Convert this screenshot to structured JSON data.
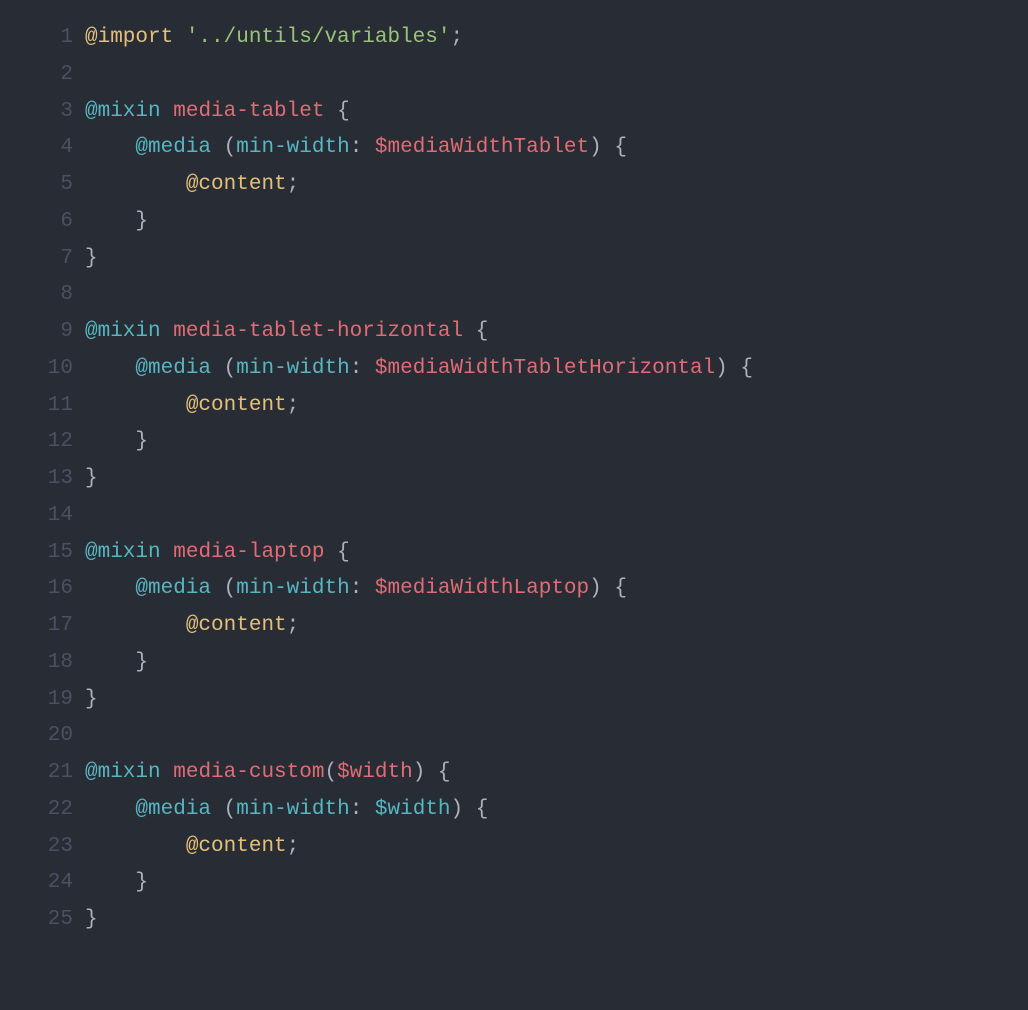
{
  "code": {
    "lines": [
      {
        "num": "1",
        "tokens": [
          {
            "cls": "t-import",
            "text": "@import"
          },
          {
            "cls": "t-punct",
            "text": " "
          },
          {
            "cls": "t-string",
            "text": "'../untils/variables'"
          },
          {
            "cls": "t-punct",
            "text": ";"
          }
        ]
      },
      {
        "num": "2",
        "tokens": []
      },
      {
        "num": "3",
        "tokens": [
          {
            "cls": "t-at",
            "text": "@mixin"
          },
          {
            "cls": "t-punct",
            "text": " "
          },
          {
            "cls": "t-mixin-name",
            "text": "media-tablet"
          },
          {
            "cls": "t-punct",
            "text": " "
          },
          {
            "cls": "t-brace",
            "text": "{"
          }
        ]
      },
      {
        "num": "4",
        "tokens": [
          {
            "cls": "t-punct",
            "text": "    "
          },
          {
            "cls": "t-at",
            "text": "@media"
          },
          {
            "cls": "t-punct",
            "text": " ("
          },
          {
            "cls": "t-prop",
            "text": "min-width"
          },
          {
            "cls": "t-punct",
            "text": ": "
          },
          {
            "cls": "t-var",
            "text": "$mediaWidthTablet"
          },
          {
            "cls": "t-punct",
            "text": ") "
          },
          {
            "cls": "t-brace",
            "text": "{"
          }
        ]
      },
      {
        "num": "5",
        "tokens": [
          {
            "cls": "t-punct",
            "text": "        "
          },
          {
            "cls": "t-content",
            "text": "@content"
          },
          {
            "cls": "t-punct",
            "text": ";"
          }
        ]
      },
      {
        "num": "6",
        "tokens": [
          {
            "cls": "t-punct",
            "text": "    "
          },
          {
            "cls": "t-brace",
            "text": "}"
          }
        ]
      },
      {
        "num": "7",
        "tokens": [
          {
            "cls": "t-brace",
            "text": "}"
          }
        ]
      },
      {
        "num": "8",
        "tokens": []
      },
      {
        "num": "9",
        "tokens": [
          {
            "cls": "t-at",
            "text": "@mixin"
          },
          {
            "cls": "t-punct",
            "text": " "
          },
          {
            "cls": "t-mixin-name",
            "text": "media-tablet-horizontal"
          },
          {
            "cls": "t-punct",
            "text": " "
          },
          {
            "cls": "t-brace",
            "text": "{"
          }
        ]
      },
      {
        "num": "10",
        "tokens": [
          {
            "cls": "t-punct",
            "text": "    "
          },
          {
            "cls": "t-at",
            "text": "@media"
          },
          {
            "cls": "t-punct",
            "text": " ("
          },
          {
            "cls": "t-prop",
            "text": "min-width"
          },
          {
            "cls": "t-punct",
            "text": ": "
          },
          {
            "cls": "t-var",
            "text": "$mediaWidthTabletHorizontal"
          },
          {
            "cls": "t-punct",
            "text": ") "
          },
          {
            "cls": "t-brace",
            "text": "{"
          }
        ]
      },
      {
        "num": "11",
        "tokens": [
          {
            "cls": "t-punct",
            "text": "        "
          },
          {
            "cls": "t-content",
            "text": "@content"
          },
          {
            "cls": "t-punct",
            "text": ";"
          }
        ]
      },
      {
        "num": "12",
        "tokens": [
          {
            "cls": "t-punct",
            "text": "    "
          },
          {
            "cls": "t-brace",
            "text": "}"
          }
        ]
      },
      {
        "num": "13",
        "tokens": [
          {
            "cls": "t-brace",
            "text": "}"
          }
        ]
      },
      {
        "num": "14",
        "tokens": []
      },
      {
        "num": "15",
        "tokens": [
          {
            "cls": "t-at",
            "text": "@mixin"
          },
          {
            "cls": "t-punct",
            "text": " "
          },
          {
            "cls": "t-mixin-name",
            "text": "media-laptop"
          },
          {
            "cls": "t-punct",
            "text": " "
          },
          {
            "cls": "t-brace",
            "text": "{"
          }
        ]
      },
      {
        "num": "16",
        "tokens": [
          {
            "cls": "t-punct",
            "text": "    "
          },
          {
            "cls": "t-at",
            "text": "@media"
          },
          {
            "cls": "t-punct",
            "text": " ("
          },
          {
            "cls": "t-prop",
            "text": "min-width"
          },
          {
            "cls": "t-punct",
            "text": ": "
          },
          {
            "cls": "t-var",
            "text": "$mediaWidthLaptop"
          },
          {
            "cls": "t-punct",
            "text": ") "
          },
          {
            "cls": "t-brace",
            "text": "{"
          }
        ]
      },
      {
        "num": "17",
        "tokens": [
          {
            "cls": "t-punct",
            "text": "        "
          },
          {
            "cls": "t-content",
            "text": "@content"
          },
          {
            "cls": "t-punct",
            "text": ";"
          }
        ]
      },
      {
        "num": "18",
        "tokens": [
          {
            "cls": "t-punct",
            "text": "    "
          },
          {
            "cls": "t-brace",
            "text": "}"
          }
        ]
      },
      {
        "num": "19",
        "tokens": [
          {
            "cls": "t-brace",
            "text": "}"
          }
        ]
      },
      {
        "num": "20",
        "tokens": []
      },
      {
        "num": "21",
        "tokens": [
          {
            "cls": "t-at",
            "text": "@mixin"
          },
          {
            "cls": "t-punct",
            "text": " "
          },
          {
            "cls": "t-mixin-name",
            "text": "media-custom"
          },
          {
            "cls": "t-punct",
            "text": "("
          },
          {
            "cls": "t-var",
            "text": "$width"
          },
          {
            "cls": "t-punct",
            "text": ") "
          },
          {
            "cls": "t-brace",
            "text": "{"
          }
        ]
      },
      {
        "num": "22",
        "tokens": [
          {
            "cls": "t-punct",
            "text": "    "
          },
          {
            "cls": "t-at",
            "text": "@media"
          },
          {
            "cls": "t-punct",
            "text": " ("
          },
          {
            "cls": "t-prop",
            "text": "min-width"
          },
          {
            "cls": "t-punct",
            "text": ": "
          },
          {
            "cls": "t-var-cyan",
            "text": "$width"
          },
          {
            "cls": "t-punct",
            "text": ") "
          },
          {
            "cls": "t-brace",
            "text": "{"
          }
        ]
      },
      {
        "num": "23",
        "tokens": [
          {
            "cls": "t-punct",
            "text": "        "
          },
          {
            "cls": "t-content",
            "text": "@content"
          },
          {
            "cls": "t-punct",
            "text": ";"
          }
        ]
      },
      {
        "num": "24",
        "tokens": [
          {
            "cls": "t-punct",
            "text": "    "
          },
          {
            "cls": "t-brace",
            "text": "}"
          }
        ]
      },
      {
        "num": "25",
        "tokens": [
          {
            "cls": "t-brace",
            "text": "}"
          }
        ]
      }
    ]
  }
}
